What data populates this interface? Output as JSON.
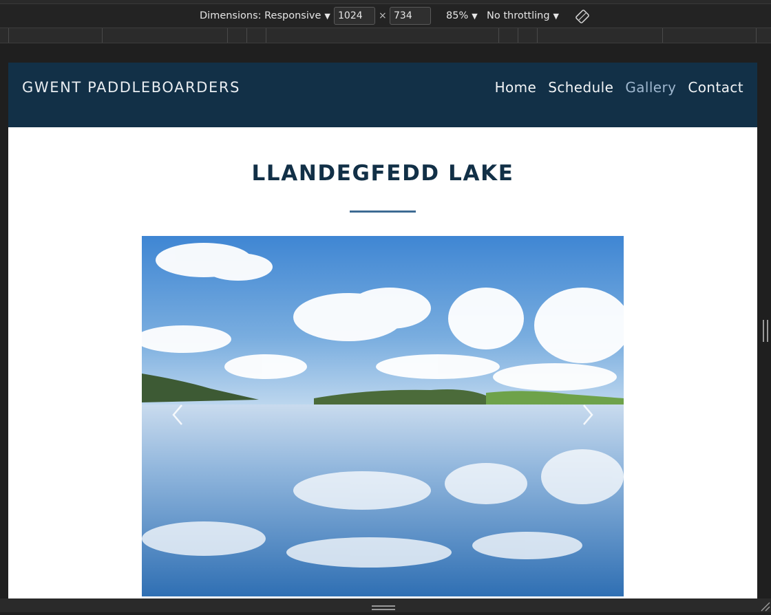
{
  "devtools": {
    "dimensions_label": "Dimensions: Responsive",
    "width_value": "1024",
    "height_value": "734",
    "times_sign": "×",
    "zoom": "85%",
    "throttling": "No throttling",
    "rotate_icon": "rotate-icon"
  },
  "site": {
    "brand": "GWENT PADDLEBOARDERS",
    "nav": [
      {
        "label": "Home"
      },
      {
        "label": "Schedule"
      },
      {
        "label": "Gallery",
        "active": true
      },
      {
        "label": "Contact"
      }
    ],
    "header_color": "#123047",
    "accent_color": "#3d6b93"
  },
  "gallery": {
    "title": "LLANDEGFEDD LAKE",
    "prev_icon": "chevron-left-icon",
    "next_icon": "chevron-right-icon"
  }
}
